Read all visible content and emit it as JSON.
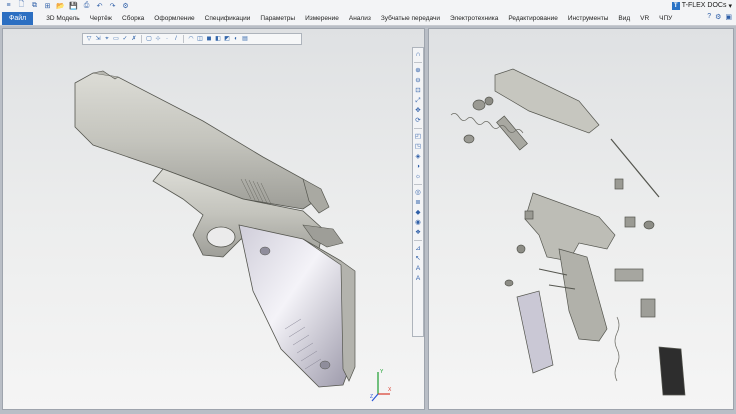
{
  "app": {
    "brand": "T-FLEX DOCs",
    "brand_caret": "▾"
  },
  "quick_access": [
    {
      "icon": "menu-icon",
      "glyph": "≡"
    },
    {
      "icon": "new-file-icon",
      "glyph": "🗋"
    },
    {
      "icon": "copy-icon",
      "glyph": "⧉"
    },
    {
      "icon": "properties-icon",
      "glyph": "⊞"
    },
    {
      "icon": "open-folder-icon",
      "glyph": "📂"
    },
    {
      "icon": "save-icon",
      "glyph": "💾"
    },
    {
      "icon": "print-icon",
      "glyph": "⎙"
    },
    {
      "icon": "undo-icon",
      "glyph": "↶"
    },
    {
      "icon": "redo-icon",
      "glyph": "↷"
    },
    {
      "icon": "settings-icon",
      "glyph": "⚙"
    }
  ],
  "menu": {
    "file": "Файл",
    "items": [
      "3D Модель",
      "Чертёж",
      "Сборка",
      "Оформление",
      "Спецификации",
      "Параметры",
      "Измерение",
      "Анализ",
      "Зубчатые передачи",
      "Электротехника",
      "Редактирование",
      "Инструменты",
      "Вид",
      "VR",
      "ЧПУ"
    ]
  },
  "menu_icons": [
    {
      "icon": "help-icon",
      "glyph": "?"
    },
    {
      "icon": "gear-icon",
      "glyph": "⚙"
    },
    {
      "icon": "layout-icon",
      "glyph": "▣"
    }
  ],
  "view_toolbar": [
    {
      "icon": "filter-icon",
      "glyph": "▽"
    },
    {
      "icon": "select-icon",
      "glyph": "⇲"
    },
    {
      "icon": "pick-icon",
      "glyph": "⌖"
    },
    {
      "icon": "box-select-icon",
      "glyph": "▭"
    },
    {
      "icon": "check-icon",
      "glyph": "✓"
    },
    {
      "icon": "cross-select-icon",
      "glyph": "✗"
    },
    {
      "icon": "frame-icon",
      "glyph": "▢"
    },
    {
      "icon": "snap-icon",
      "glyph": "⊹"
    },
    {
      "icon": "point-icon",
      "glyph": "·"
    },
    {
      "icon": "line-icon",
      "glyph": "/"
    },
    {
      "icon": "arc-icon",
      "glyph": "◠"
    },
    {
      "icon": "face-icon",
      "glyph": "◫"
    },
    {
      "icon": "body-icon",
      "glyph": "◼"
    },
    {
      "icon": "solid-icon",
      "glyph": "◧"
    },
    {
      "icon": "cube-icon",
      "glyph": "◩"
    },
    {
      "icon": "shade-icon",
      "glyph": "◐"
    },
    {
      "icon": "sheet-icon",
      "glyph": "▤"
    }
  ],
  "side_toolbar": [
    {
      "icon": "magnet-icon",
      "glyph": "∩"
    },
    {
      "icon": "zoom-in-icon",
      "glyph": "⊕"
    },
    {
      "icon": "zoom-out-icon",
      "glyph": "⊖"
    },
    {
      "icon": "zoom-window-icon",
      "glyph": "⊡"
    },
    {
      "icon": "zoom-all-icon",
      "glyph": "⤢"
    },
    {
      "icon": "pan-icon",
      "glyph": "✥"
    },
    {
      "icon": "rotate-icon",
      "glyph": "⟳"
    },
    {
      "icon": "view-front-icon",
      "glyph": "◰"
    },
    {
      "icon": "view-top-icon",
      "glyph": "◳"
    },
    {
      "icon": "view-iso-icon",
      "glyph": "◈"
    },
    {
      "icon": "section-icon",
      "glyph": "◑"
    },
    {
      "icon": "light-icon",
      "glyph": "☼"
    },
    {
      "icon": "camera-icon",
      "glyph": "◎"
    },
    {
      "icon": "layers-icon",
      "glyph": "≣"
    },
    {
      "icon": "shading-icon",
      "glyph": "◆"
    },
    {
      "icon": "material-icon",
      "glyph": "◉"
    },
    {
      "icon": "render-icon",
      "glyph": "❖"
    },
    {
      "icon": "measure-icon",
      "glyph": "⊿"
    },
    {
      "icon": "cursor-icon",
      "glyph": "↖"
    },
    {
      "icon": "text-icon",
      "glyph": "A"
    },
    {
      "icon": "text-bold-icon",
      "glyph": "A"
    }
  ],
  "triad": {
    "x": "X",
    "y": "Y",
    "z": "Z"
  },
  "colors": {
    "accent": "#2c6fc2",
    "model_steel": "#c9c9c3",
    "model_grip": "#b8b6c4",
    "viewport_bg": "#ececed"
  }
}
